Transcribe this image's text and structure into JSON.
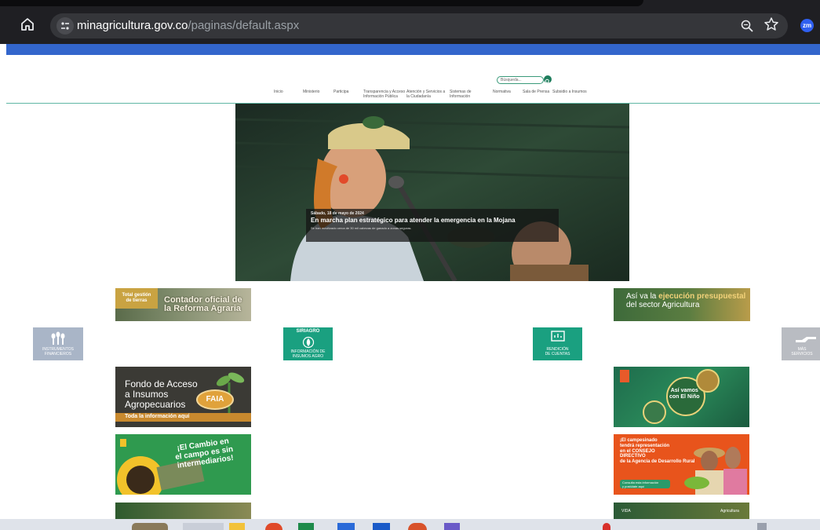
{
  "browser": {
    "url_host": "minagricultura.gov.co",
    "url_path": "/paginas/default.aspx",
    "profile_initials": "zm",
    "icons": [
      "home-icon",
      "site-info-icon",
      "zoom-icon",
      "star-icon"
    ]
  },
  "site": {
    "search_placeholder": "Búsqueda...",
    "nav": [
      "Inicio",
      "Ministerio",
      "Participa",
      "Transparencia y Acceso\nInformación Pública",
      "Atención y Servicios a\nla Ciudadanía",
      "Sistemas de\nInformación",
      "Normativa",
      "Sala de Prensa",
      "Subsidio a Insumos"
    ]
  },
  "hero": {
    "date": "Sábado, 18 de mayo de 2024",
    "title": "En marcha plan estratégico para atender la emergencia en la Mojana",
    "subtitle": "Se han movilizado cerca de 30 mil cabezas de ganado a zonas seguras."
  },
  "banners": {
    "tierras_tag": "Total gestión\nde tierras",
    "tierras_text": "Contador oficial de\nla Reforma Agraria",
    "ejecucion_prefix": "Así va la ",
    "ejecucion_bold": "ejecución presupuestal",
    "ejecucion_suffix": "del sector Agricultura",
    "instrumentos": "INSTRUMENTOS\nFINANCIEROS",
    "siriagro_top": "SIRIAGRO",
    "siriagro_bottom": "INFORMACIÓN DE\nINSUMOS AGRO",
    "rendicion": "RENDICIÓN\nDE CUENTAS",
    "mas_servicios": "MÁS\nSERVICIOS",
    "faia_text": "Fondo de Acceso\na Insumos\nAgropecuarios",
    "faia_logo": "FAIA",
    "faia_foot": "Toda la información aquí",
    "nino_text": "Así vamos\ncon El Niño",
    "cambio_text": "¡El Cambio en\nel campo es sin\nintermediarios!",
    "consejo_text": "¡El campesinado\ntendrá representación\nen el CONSEJO\nDIRECTIVO\nde la Agencia de Desarrollo Rural",
    "consejo_cta": "Consulta esta información\ny postúlate aquí",
    "bottom_right_left": "VIDA",
    "bottom_right_right": "Agricultura"
  },
  "colors": {
    "browser_bg": "#1f1f23",
    "gov_strip": "#3366cc",
    "accent_green": "#1aa080",
    "header_line": "#5fb7a4"
  }
}
